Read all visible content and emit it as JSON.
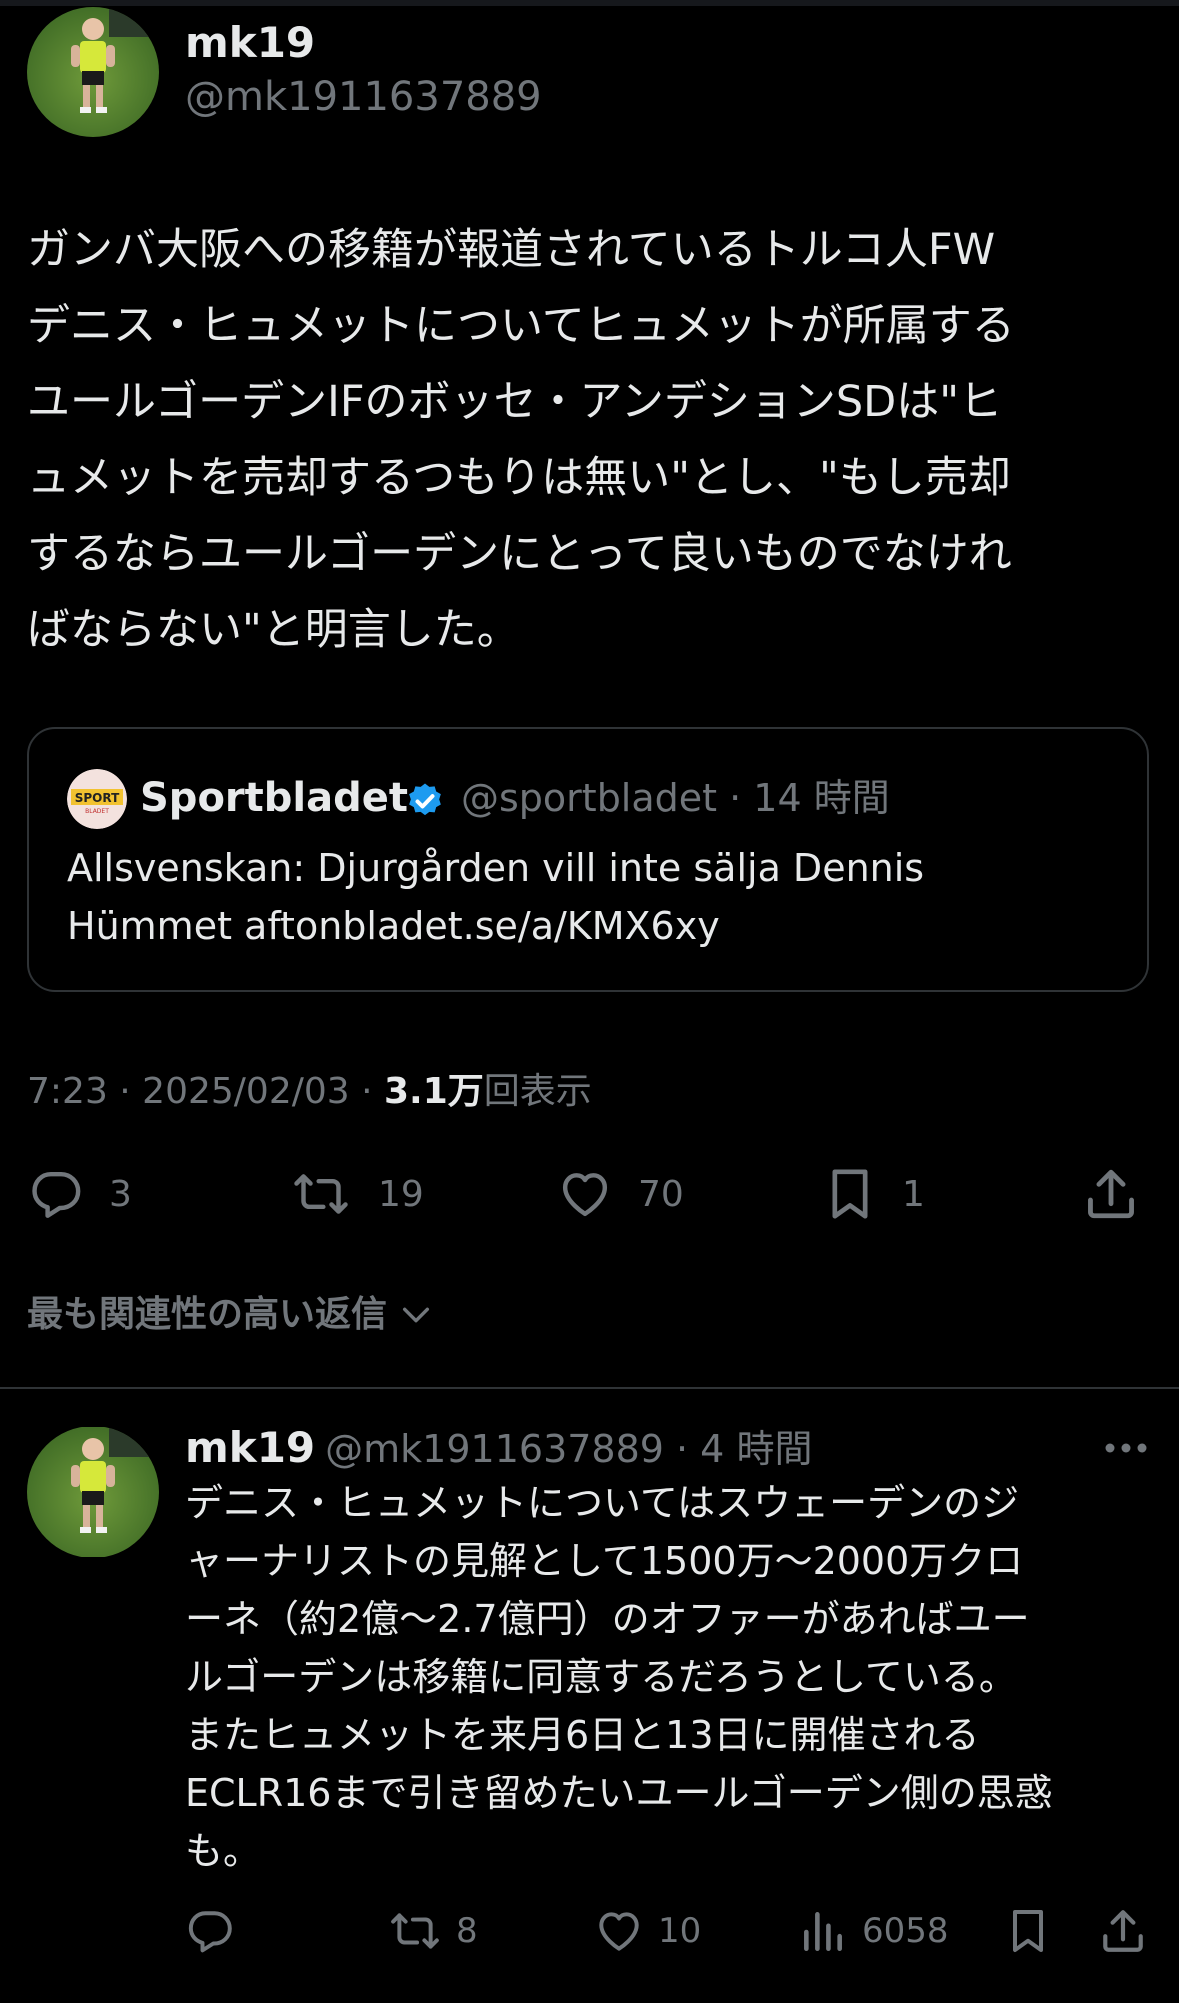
{
  "main_tweet": {
    "author_name": "mk19",
    "handle": "@mk1911637889",
    "text_lines": [
      "ガンバ大阪への移籍が報道されているトルコ人FW",
      "デニス・ヒュメットについてヒュメットが所属する",
      "ユールゴーデンIFのボッセ・アンデションSDは\"ヒ",
      "ュメットを売却するつもりは無い\"とし、\"もし売却",
      "するならユールゴーデンにとって良いものでなけれ",
      "ばならない\"と明言した。"
    ],
    "quote": {
      "avatar_text": "SPORT",
      "avatar_subtext": "BLADET",
      "name": "Sportbladet",
      "handle_time": "@sportbladet · 14 時間",
      "text_lines": [
        "Allsvenskan: Djurgården vill inte sälja Dennis",
        "Hümmet aftonbladet.se/a/KMX6xy"
      ]
    },
    "meta": {
      "time_date": "7:23 · 2025/02/03 · ",
      "views_count": "3.1万",
      "views_label": "回表示"
    },
    "actions": {
      "replies": "3",
      "reposts": "19",
      "likes": "70",
      "bookmarks": "1"
    },
    "icons": [
      "reply-icon",
      "repost-icon",
      "like-icon",
      "bookmark-icon",
      "share-icon"
    ]
  },
  "replies_sort": {
    "label": "最も関連性の高い返信",
    "icon": "chevron-down-icon"
  },
  "reply": {
    "author_name": "mk19",
    "handle_time": "@mk1911637889 · 4 時間",
    "text_lines": [
      "デニス・ヒュメットについてはスウェーデンのジ",
      "ャーナリストの見解として1500万～2000万クロ",
      "ーネ（約2億～2.7億円）のオファーがあればユー",
      "ルゴーデンは移籍に同意するだろうとしている。",
      "またヒュメットを来月6日と13日に開催される",
      "ECLR16まで引き留めたいユールゴーデン側の思惑",
      "も。"
    ],
    "actions": {
      "replies": "",
      "reposts": "8",
      "likes": "10",
      "views": "6058"
    },
    "icons": [
      "reply-icon",
      "repost-icon",
      "like-icon",
      "views-icon",
      "bookmark-icon",
      "share-icon",
      "more-icon"
    ]
  },
  "colors": {
    "background": "#000000",
    "text_primary": "#e7e9ea",
    "text_secondary": "#71767b",
    "border": "#2f3336",
    "verified": "#1d9bf0"
  }
}
